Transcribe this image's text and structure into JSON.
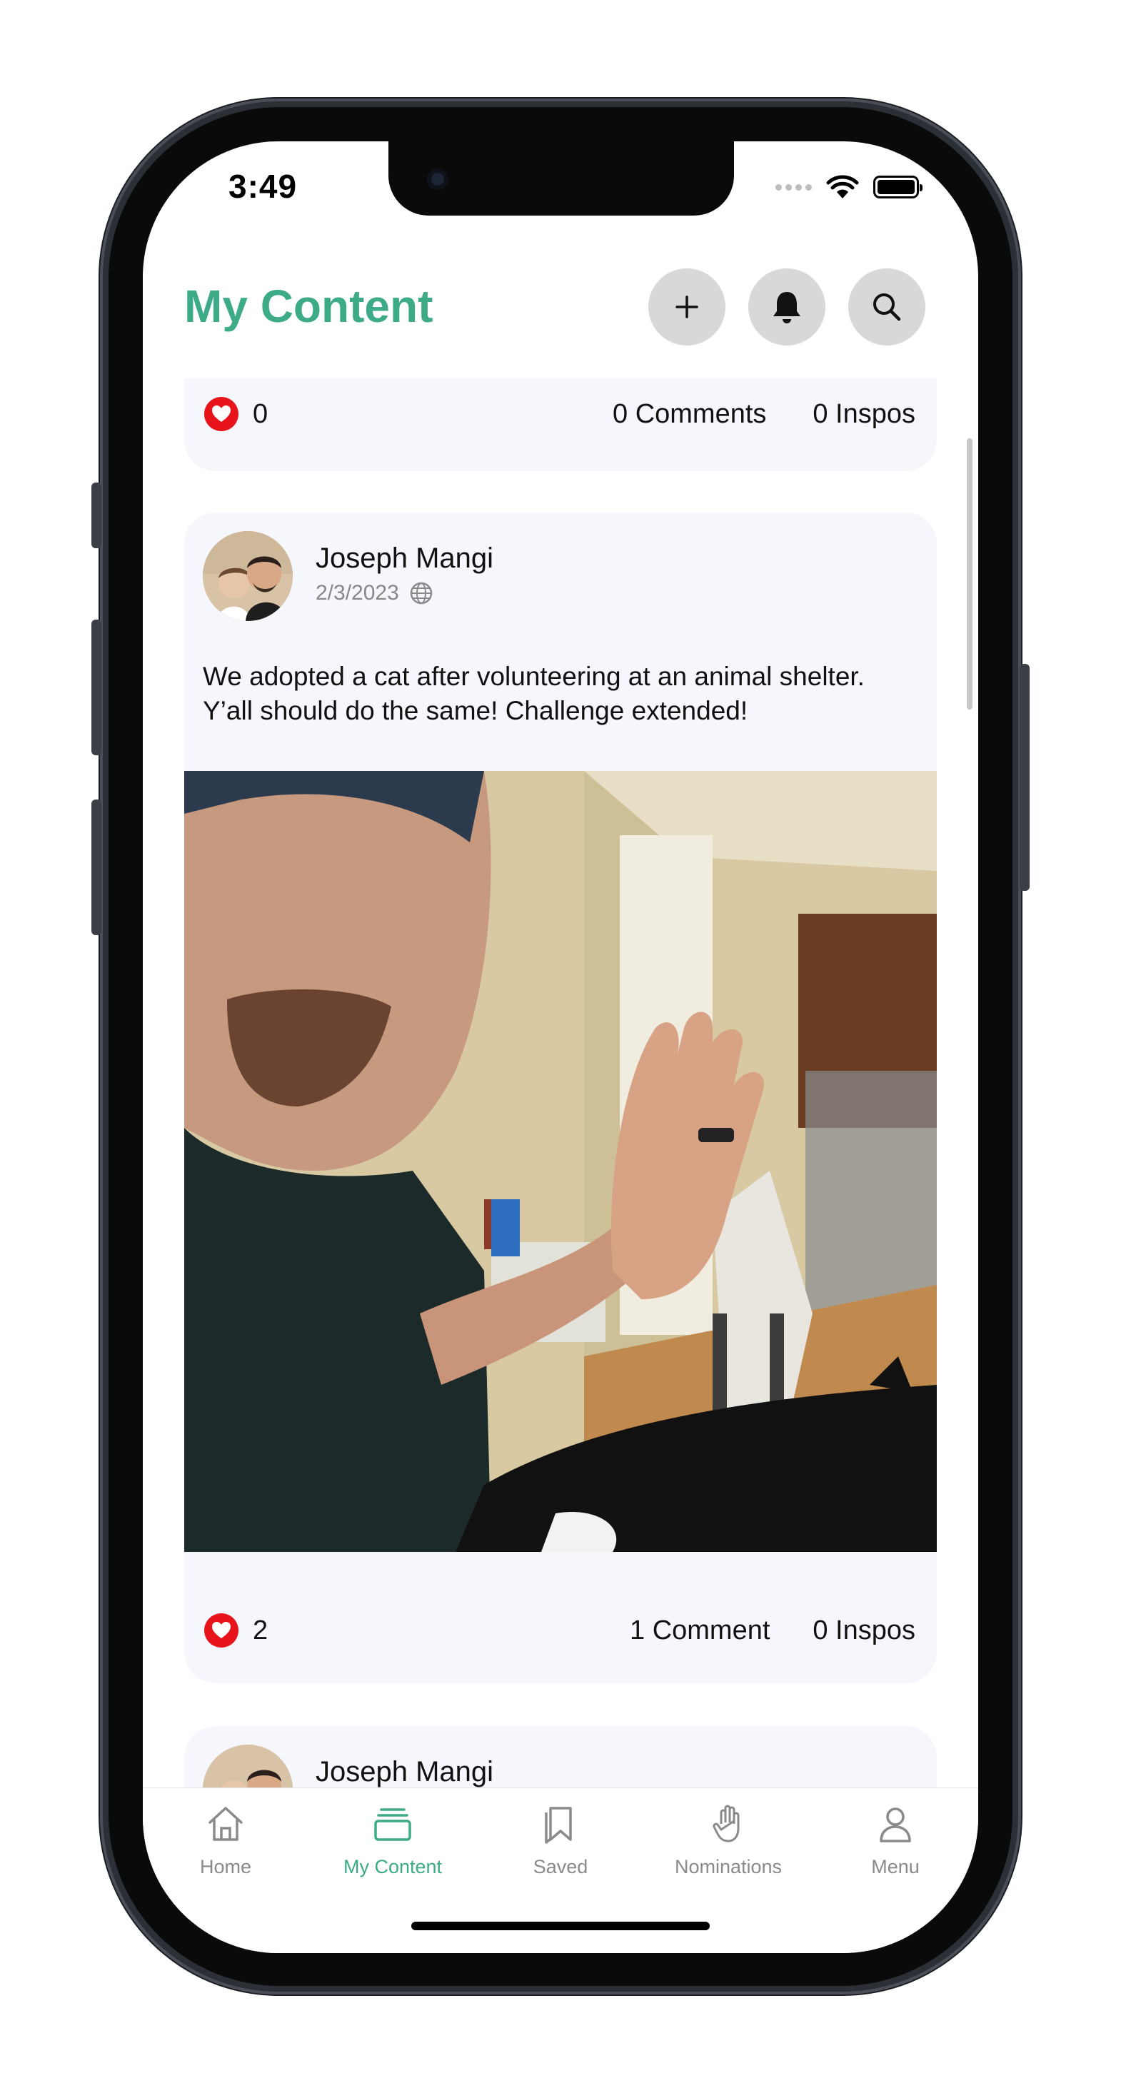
{
  "status_bar": {
    "time": "3:49"
  },
  "header": {
    "title": "My Content",
    "title_color": "#3dab87"
  },
  "header_buttons": [
    {
      "name": "add-button",
      "icon": "plus-icon"
    },
    {
      "name": "notifications-button",
      "icon": "bell-icon"
    },
    {
      "name": "search-button",
      "icon": "search-icon"
    }
  ],
  "posts": [
    {
      "likes": "0",
      "comments": "0 Comments",
      "inspos": "0 Inspos"
    },
    {
      "author": "Joseph Mangi",
      "date": "2/3/2023",
      "visibility_icon": "globe-icon",
      "text": "We adopted a cat after volunteering at an animal shelter. Y’all should do the same! Challenge extended!",
      "likes": "2",
      "comments": "1 Comment",
      "inspos": "0 Inspos"
    },
    {
      "author": "Joseph Mangi"
    }
  ],
  "tabbar": {
    "active_color": "#3dab87",
    "items": [
      {
        "label": "Home",
        "icon": "home-icon"
      },
      {
        "label": "My Content",
        "icon": "stack-icon"
      },
      {
        "label": "Saved",
        "icon": "bookmark-icon"
      },
      {
        "label": "Nominations",
        "icon": "hand-icon"
      },
      {
        "label": "Menu",
        "icon": "person-icon"
      }
    ]
  }
}
